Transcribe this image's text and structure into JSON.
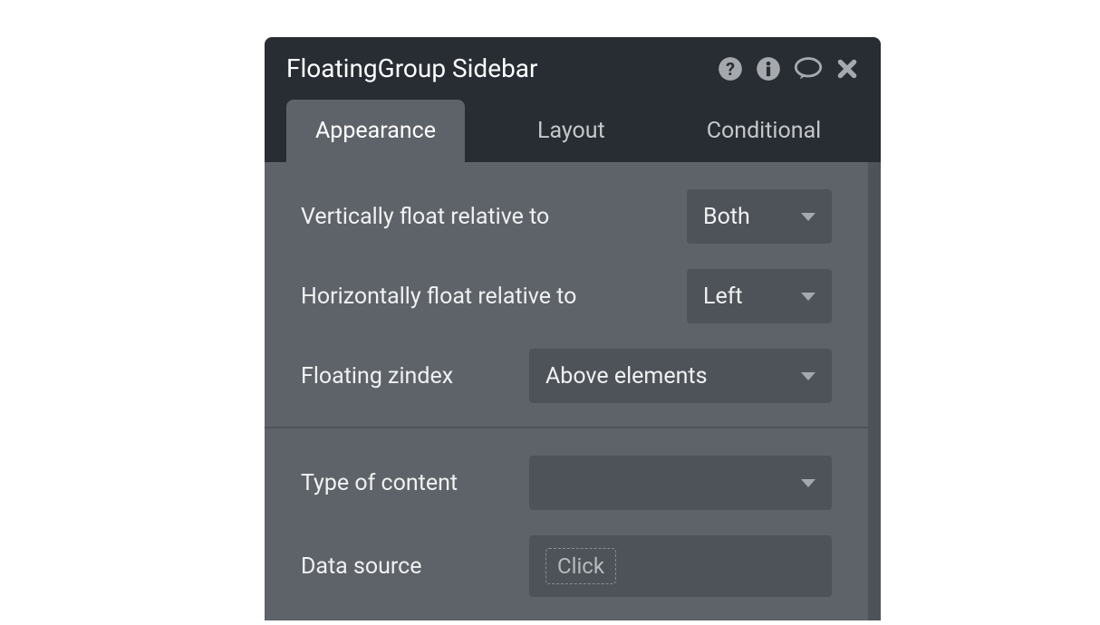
{
  "panel": {
    "title": "FloatingGroup Sidebar"
  },
  "tabs": {
    "appearance": "Appearance",
    "layout": "Layout",
    "conditional": "Conditional"
  },
  "properties": {
    "vertical_float": {
      "label": "Vertically float relative to",
      "value": "Both"
    },
    "horizontal_float": {
      "label": "Horizontally float relative to",
      "value": "Left"
    },
    "floating_zindex": {
      "label": "Floating zindex",
      "value": "Above elements"
    },
    "type_of_content": {
      "label": "Type of content",
      "value": ""
    },
    "data_source": {
      "label": "Data source",
      "placeholder": "Click"
    }
  }
}
